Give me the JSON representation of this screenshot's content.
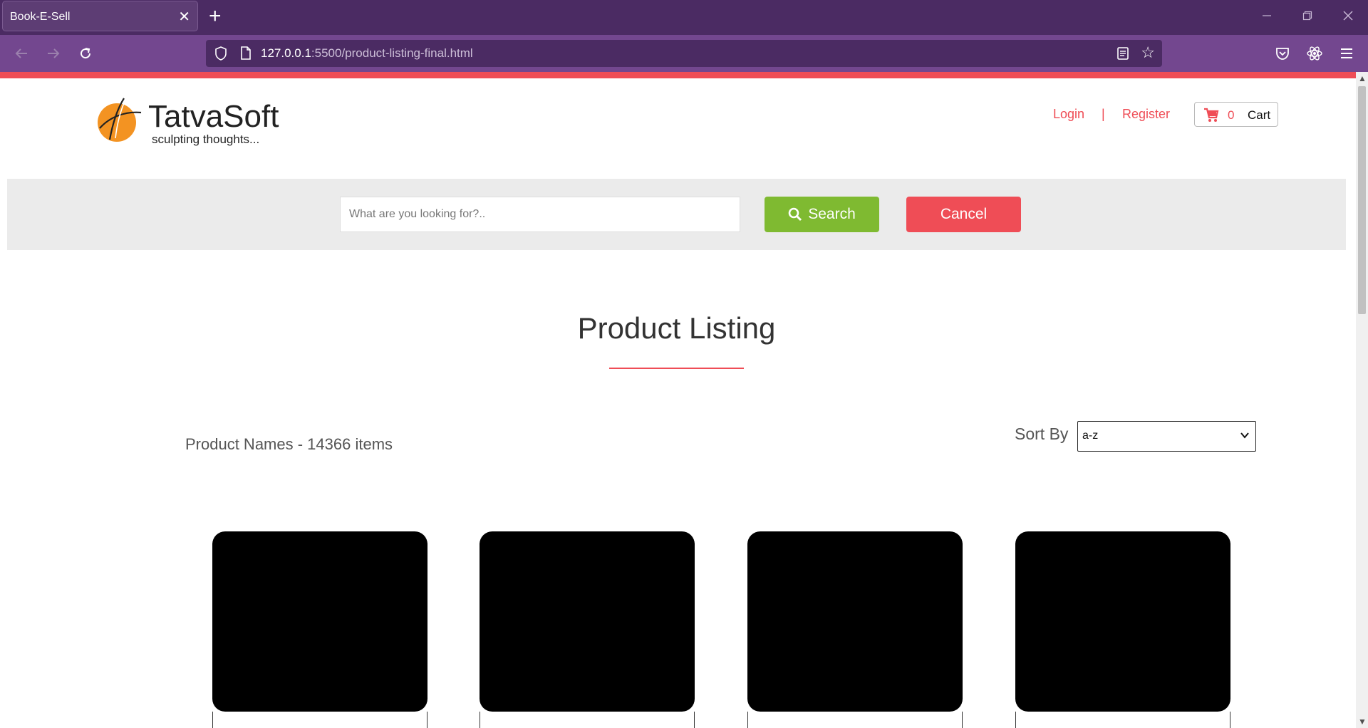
{
  "browser": {
    "tab_title": "Book-E-Sell",
    "tab_close": "✕",
    "new_tab": "+",
    "url_host": "127.0.0.1",
    "url_rest": ":5500/product-listing-final.html"
  },
  "header": {
    "brand_name": "TatvaSoft",
    "brand_tagline": "sculpting thoughts...",
    "login_label": "Login",
    "separator": "|",
    "register_label": "Register",
    "cart_count": "0",
    "cart_label": "Cart"
  },
  "search": {
    "placeholder": "What are you looking for?..",
    "search_label": "Search",
    "cancel_label": "Cancel"
  },
  "main": {
    "title": "Product Listing",
    "product_count_text": "Product Names - 14366 items",
    "sort_label": "Sort By",
    "sort_value": "a-z"
  },
  "colors": {
    "accent": "#ef4d56",
    "search_button": "#7fba31",
    "browser_titlebar": "#4b2b63",
    "browser_toolbar": "#73478f"
  },
  "products": [
    {
      "image": "black"
    },
    {
      "image": "black"
    },
    {
      "image": "black"
    },
    {
      "image": "black"
    }
  ]
}
